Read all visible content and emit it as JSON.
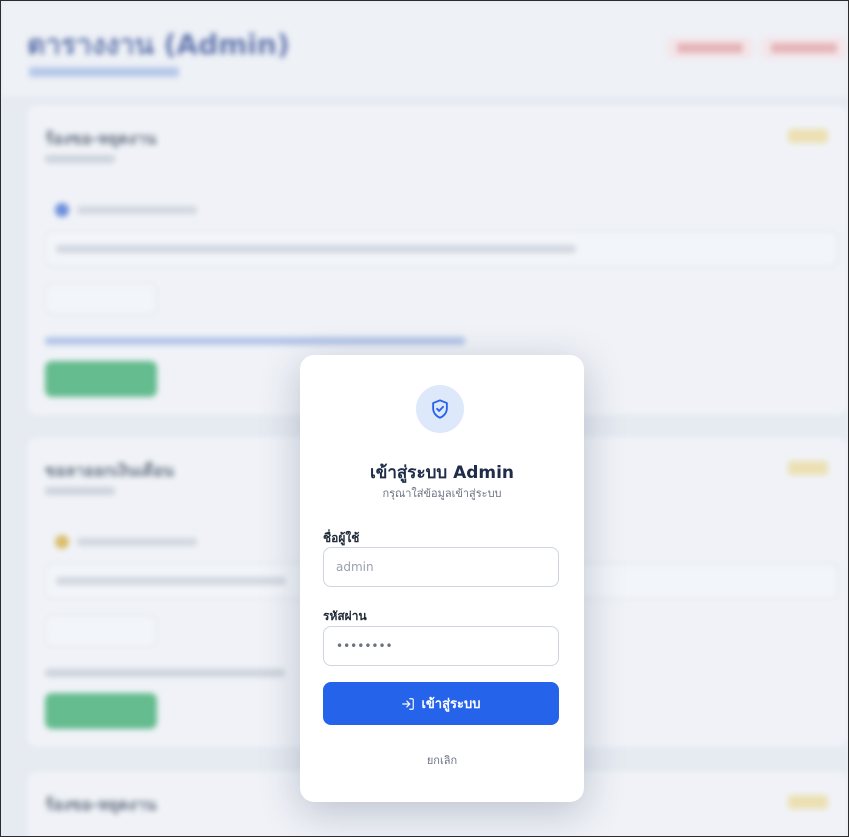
{
  "background": {
    "title": "ตารางงาน (Admin)",
    "cards": [
      {
        "name": "ร้องขอ-หยุดงาน"
      },
      {
        "name": "ขอลาออกเงินเดือน"
      },
      {
        "name": "ร้องขอ-หยุดงาน"
      }
    ]
  },
  "modal": {
    "icon": "shield-check-icon",
    "title": "เข้าสู่ระบบ Admin",
    "subtitle": "กรุณาใส่ข้อมูลเข้าสู่ระบบ",
    "username_label": "ชื่อผู้ใช้",
    "username_placeholder": "admin",
    "password_label": "รหัสผ่าน",
    "password_value": "••••••••",
    "login_button": "เข้าสู่ระบบ",
    "login_icon": "login-arrow-icon",
    "cancel": "ยกเลิก"
  },
  "colors": {
    "primary": "#2563eb",
    "title": "#1f2d4a",
    "success": "#22a55a"
  }
}
